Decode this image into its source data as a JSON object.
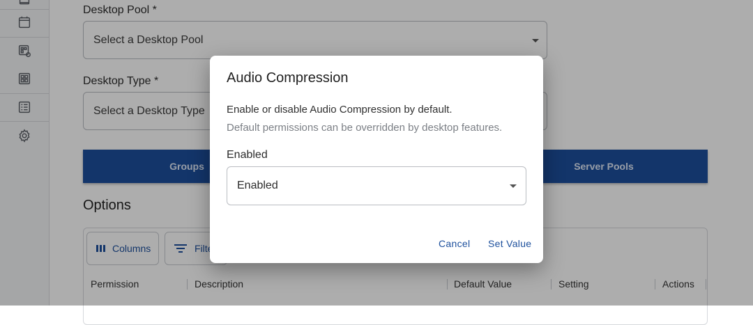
{
  "sidebar": {
    "icons": [
      "list-top-icon",
      "calendar-icon",
      "app-link-icon",
      "grid-apps-icon",
      "list-details-icon",
      "settings-gear-icon"
    ]
  },
  "form": {
    "pool_label": "Desktop Pool *",
    "pool_placeholder": "Select a Desktop Pool",
    "type_label": "Desktop Type *",
    "type_placeholder": "Select a Desktop Type"
  },
  "tabs": [
    "Groups",
    "Server Pools"
  ],
  "options": {
    "title": "Options",
    "columns_button": "Columns",
    "filters_button": "Filte",
    "headers": [
      "Permission",
      "Description",
      "Default Value",
      "Setting",
      "Actions"
    ]
  },
  "dialog": {
    "title": "Audio Compression",
    "description": "Enable or disable Audio Compression by default.",
    "note": "Default permissions can be overridden by desktop features.",
    "field_label": "Enabled",
    "field_value": "Enabled",
    "cancel_label": "Cancel",
    "submit_label": "Set Value"
  },
  "colors": {
    "accent": "#1c4f9c",
    "scrim": "rgba(0,0,0,0.32)"
  }
}
